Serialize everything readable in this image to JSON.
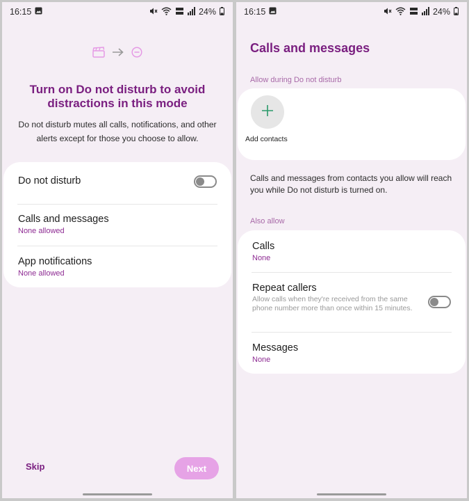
{
  "status_bar": {
    "time": "16:15",
    "battery": "24%"
  },
  "left": {
    "intro_title": "Turn on Do not disturb to avoid distractions in this mode",
    "intro_desc": "Do not disturb mutes all calls, notifications, and other alerts except for those you choose to allow.",
    "rows": [
      {
        "title": "Do not disturb"
      },
      {
        "title": "Calls and messages",
        "subtitle": "None allowed"
      },
      {
        "title": "App notifications",
        "subtitle": "None allowed"
      }
    ],
    "skip_label": "Skip",
    "next_label": "Next"
  },
  "right": {
    "page_title": "Calls and messages",
    "section_allow": "Allow during Do not disturb",
    "add_contacts": "Add contacts",
    "info_text": "Calls and messages from contacts you allow will reach you while Do not disturb is turned on.",
    "section_also": "Also allow",
    "rows": [
      {
        "title": "Calls",
        "subtitle": "None"
      },
      {
        "title": "Repeat callers",
        "desc": "Allow calls when they're received from the same phone number more than once within 15 minutes."
      },
      {
        "title": "Messages",
        "subtitle": "None"
      }
    ]
  },
  "colors": {
    "accent": "#7a1f80",
    "background": "#f5eef5",
    "card": "#ffffff",
    "next_button": "#e6a3e6"
  },
  "toggles": {
    "do_not_disturb": false,
    "repeat_callers": false
  },
  "icons": [
    "image-icon",
    "mute-icon",
    "wifi-icon",
    "volte-icon",
    "signal-icon",
    "battery-icon",
    "clapperboard-icon",
    "arrow-right-icon",
    "dnd-icon",
    "plus-icon"
  ]
}
